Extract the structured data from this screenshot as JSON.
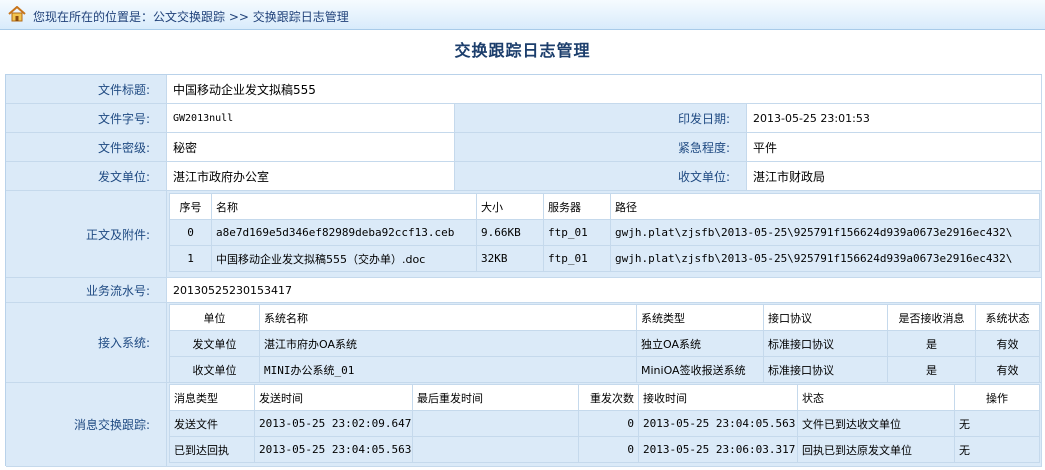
{
  "breadcrumb": {
    "text": "您现在所在的位置是：公文交换跟踪 >> 交换跟踪日志管理"
  },
  "page_title": "交换跟踪日志管理",
  "form": {
    "doc_title_label": "文件标题:",
    "doc_title_value": "中国移动企业发文拟稿555",
    "doc_number_label": "文件字号:",
    "doc_number_value": "GW2013null",
    "issue_date_label": "印发日期:",
    "issue_date_value": "2013-05-25 23:01:53",
    "secrecy_label": "文件密级:",
    "secrecy_value": "秘密",
    "urgency_label": "紧急程度:",
    "urgency_value": "平件",
    "sender_label": "发文单位:",
    "sender_value": "湛江市政府办公室",
    "receiver_label": "收文单位:",
    "receiver_value": "湛江市财政局",
    "attachments_label": "正文及附件:",
    "flow_number_label": "业务流水号:",
    "flow_number_value": "20130525230153417",
    "access_label": "接入系统:",
    "msg_track_label": "消息交换跟踪:"
  },
  "attachments": {
    "headers": [
      "序号",
      "名称",
      "大小",
      "服务器",
      "路径"
    ],
    "rows": [
      [
        "0",
        "a8e7d169e5d346ef82989deba92ccf13.ceb",
        "9.66KB",
        "ftp_01",
        "gwjh.plat\\zjsfb\\2013-05-25\\925791f156624d939a0673e2916ec432\\"
      ],
      [
        "1",
        "中国移动企业发文拟稿555（交办单）.doc",
        "32KB",
        "ftp_01",
        "gwjh.plat\\zjsfb\\2013-05-25\\925791f156624d939a0673e2916ec432\\"
      ]
    ]
  },
  "access_systems": {
    "headers": [
      "单位",
      "系统名称",
      "系统类型",
      "接口协议",
      "是否接收消息",
      "系统状态"
    ],
    "rows": [
      [
        "发文单位",
        "湛江市府办OA系统",
        "独立OA系统",
        "标准接口协议",
        "是",
        "有效"
      ],
      [
        "收文单位",
        "MINI办公系统_01",
        "MiniOA签收报送系统",
        "标准接口协议",
        "是",
        "有效"
      ]
    ]
  },
  "message_tracking": {
    "headers": [
      "消息类型",
      "发送时间",
      "最后重发时间",
      "重发次数",
      "接收时间",
      "状态",
      "操作"
    ],
    "rows": [
      [
        "发送文件",
        "2013-05-25 23:02:09.647",
        "",
        "0",
        "2013-05-25 23:04:05.563",
        "文件已到达收文单位",
        "无"
      ],
      [
        "已到达回执",
        "2013-05-25 23:04:05.563",
        "",
        "0",
        "2013-05-25 23:06:03.317",
        "回执已到达原发文单位",
        "无"
      ]
    ]
  },
  "colors": {
    "label_bg": "#dbeaf8",
    "label_text": "#1f4a82",
    "border": "#c5d9ec",
    "title": "#1c3e6c"
  }
}
